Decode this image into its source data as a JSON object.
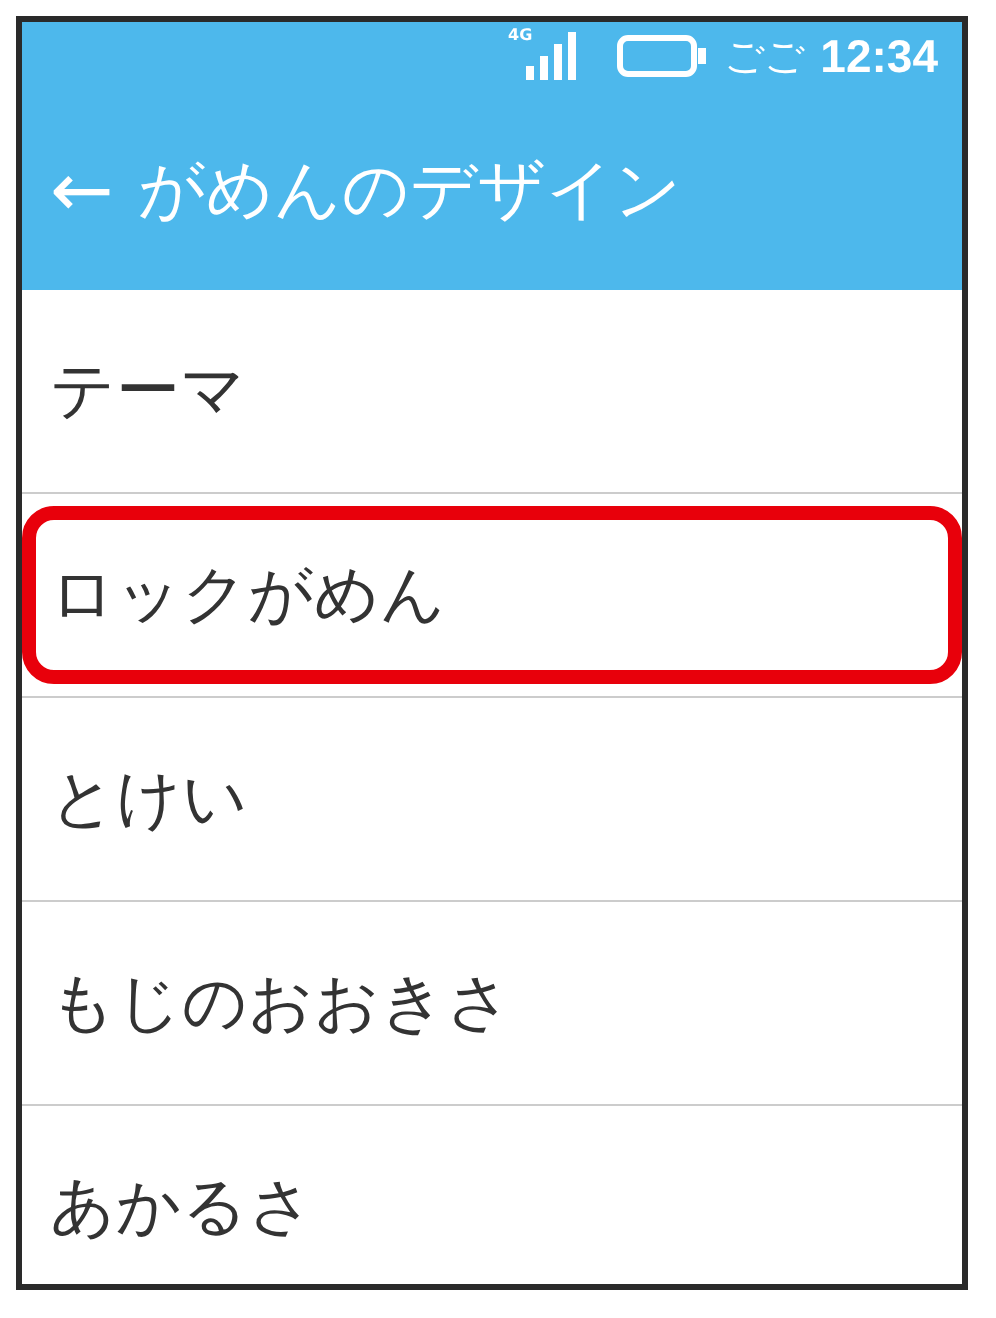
{
  "status_bar": {
    "network": "4G",
    "period": "ごご",
    "time": "12:34"
  },
  "header": {
    "back": "←",
    "title": "がめんのデザイン"
  },
  "items": [
    {
      "label": "テーマ",
      "highlighted": false
    },
    {
      "label": "ロックがめん",
      "highlighted": true
    },
    {
      "label": "とけい",
      "highlighted": false
    },
    {
      "label": "もじのおおきさ",
      "highlighted": false
    },
    {
      "label": "あかるさ",
      "highlighted": false
    }
  ]
}
